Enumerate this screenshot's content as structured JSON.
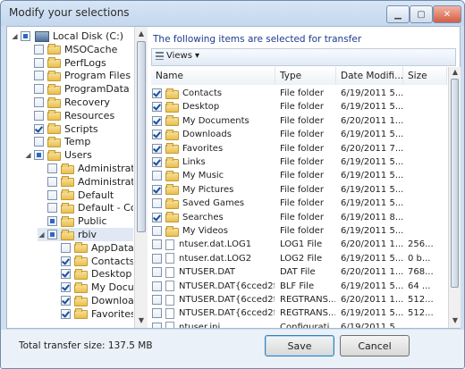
{
  "window": {
    "title": "Modify your selections"
  },
  "tree": {
    "items": [
      {
        "label": "Local Disk (C:)",
        "state": "partial",
        "icon": "disk-icon",
        "level": 0
      },
      {
        "label": "MSOCache",
        "state": "unchecked",
        "icon": "folder-icon",
        "level": 1
      },
      {
        "label": "PerfLogs",
        "state": "unchecked",
        "icon": "folder-icon",
        "level": 1
      },
      {
        "label": "Program Files",
        "state": "unchecked",
        "icon": "folder-icon",
        "level": 1
      },
      {
        "label": "ProgramData",
        "state": "unchecked",
        "icon": "folder-icon",
        "level": 1
      },
      {
        "label": "Recovery",
        "state": "unchecked",
        "icon": "folder-icon",
        "level": 1
      },
      {
        "label": "Resources",
        "state": "unchecked",
        "icon": "folder-icon",
        "level": 1
      },
      {
        "label": "Scripts",
        "state": "checked",
        "icon": "folder-icon",
        "level": 1
      },
      {
        "label": "Temp",
        "state": "unchecked",
        "icon": "folder-icon",
        "level": 1
      },
      {
        "label": "Users",
        "state": "partial",
        "icon": "folder-icon",
        "level": 1
      },
      {
        "label": "Administrator",
        "state": "unchecked",
        "icon": "folder-icon",
        "level": 2
      },
      {
        "label": "Administrator",
        "state": "unchecked",
        "icon": "user-folder-icon",
        "level": 2
      },
      {
        "label": "Default",
        "state": "unchecked",
        "icon": "folder-icon",
        "level": 2
      },
      {
        "label": "Default - Copy",
        "state": "unchecked",
        "icon": "folder-icon",
        "level": 2
      },
      {
        "label": "Public",
        "state": "partial",
        "icon": "folder-icon",
        "level": 2
      },
      {
        "label": "rbiv",
        "state": "partial",
        "icon": "folder-icon",
        "level": 2,
        "selected": true
      },
      {
        "label": "AppData",
        "state": "unchecked",
        "icon": "folder-icon",
        "level": 3
      },
      {
        "label": "Contacts",
        "state": "checked",
        "icon": "folder-icon",
        "level": 3
      },
      {
        "label": "Desktop",
        "state": "checked",
        "icon": "folder-icon",
        "level": 3
      },
      {
        "label": "My Docum",
        "state": "checked",
        "icon": "folder-icon",
        "level": 3
      },
      {
        "label": "Download",
        "state": "checked",
        "icon": "folder-icon",
        "level": 3
      },
      {
        "label": "Favorites",
        "state": "checked",
        "icon": "folder-icon",
        "level": 3
      }
    ]
  },
  "right": {
    "info_text": "The following items are selected for transfer",
    "views_label": "Views",
    "columns": [
      "Name",
      "Type",
      "Date Modifi...",
      "Size"
    ],
    "rows": [
      {
        "name": "Contacts",
        "type": "File folder",
        "date": "6/19/2011 5...",
        "size": "",
        "checked": true,
        "icon": "folder-icon"
      },
      {
        "name": "Desktop",
        "type": "File folder",
        "date": "6/19/2011 5...",
        "size": "",
        "checked": true,
        "icon": "folder-icon"
      },
      {
        "name": "My Documents",
        "type": "File folder",
        "date": "6/20/2011 1...",
        "size": "",
        "checked": true,
        "icon": "folder-icon"
      },
      {
        "name": "Downloads",
        "type": "File folder",
        "date": "6/19/2011 5...",
        "size": "",
        "checked": true,
        "icon": "folder-icon"
      },
      {
        "name": "Favorites",
        "type": "File folder",
        "date": "6/20/2011 7...",
        "size": "",
        "checked": true,
        "icon": "folder-icon"
      },
      {
        "name": "Links",
        "type": "File folder",
        "date": "6/19/2011 5...",
        "size": "",
        "checked": true,
        "icon": "folder-icon"
      },
      {
        "name": "My Music",
        "type": "File folder",
        "date": "6/19/2011 5...",
        "size": "",
        "checked": false,
        "icon": "folder-icon"
      },
      {
        "name": "My Pictures",
        "type": "File folder",
        "date": "6/19/2011 5...",
        "size": "",
        "checked": true,
        "icon": "folder-icon"
      },
      {
        "name": "Saved Games",
        "type": "File folder",
        "date": "6/19/2011 5...",
        "size": "",
        "checked": false,
        "icon": "folder-icon"
      },
      {
        "name": "Searches",
        "type": "File folder",
        "date": "6/19/2011 8...",
        "size": "",
        "checked": true,
        "icon": "folder-icon"
      },
      {
        "name": "My Videos",
        "type": "File folder",
        "date": "6/19/2011 5...",
        "size": "",
        "checked": false,
        "icon": "folder-icon"
      },
      {
        "name": "ntuser.dat.LOG1",
        "type": "LOG1 File",
        "date": "6/20/2011 1...",
        "size": "256...",
        "checked": false,
        "icon": "file-icon"
      },
      {
        "name": "ntuser.dat.LOG2",
        "type": "LOG2 File",
        "date": "6/19/2011 5...",
        "size": "0 b...",
        "checked": false,
        "icon": "file-icon"
      },
      {
        "name": "NTUSER.DAT",
        "type": "DAT File",
        "date": "6/20/2011 1...",
        "size": "768...",
        "checked": false,
        "icon": "file-icon"
      },
      {
        "name": "NTUSER.DAT{6cced2f...",
        "type": "BLF File",
        "date": "6/19/2011 5...",
        "size": "64 ...",
        "checked": false,
        "icon": "file-icon"
      },
      {
        "name": "NTUSER.DAT{6cced2f...",
        "type": "REGTRANS...",
        "date": "6/20/2011 1...",
        "size": "512...",
        "checked": false,
        "icon": "file-icon"
      },
      {
        "name": "NTUSER.DAT{6cced2f...",
        "type": "REGTRANS...",
        "date": "6/19/2011 5...",
        "size": "512...",
        "checked": false,
        "icon": "file-icon"
      },
      {
        "name": "ntuser.ini",
        "type": "Configurati...",
        "date": "6/19/2011 5...",
        "size": "",
        "checked": false,
        "icon": "file-icon"
      }
    ]
  },
  "footer": {
    "total": "Total transfer size: 137.5 MB",
    "save": "Save",
    "cancel": "Cancel"
  },
  "controls": {
    "minimize": "▁",
    "maximize": "▢",
    "close": "✕"
  }
}
